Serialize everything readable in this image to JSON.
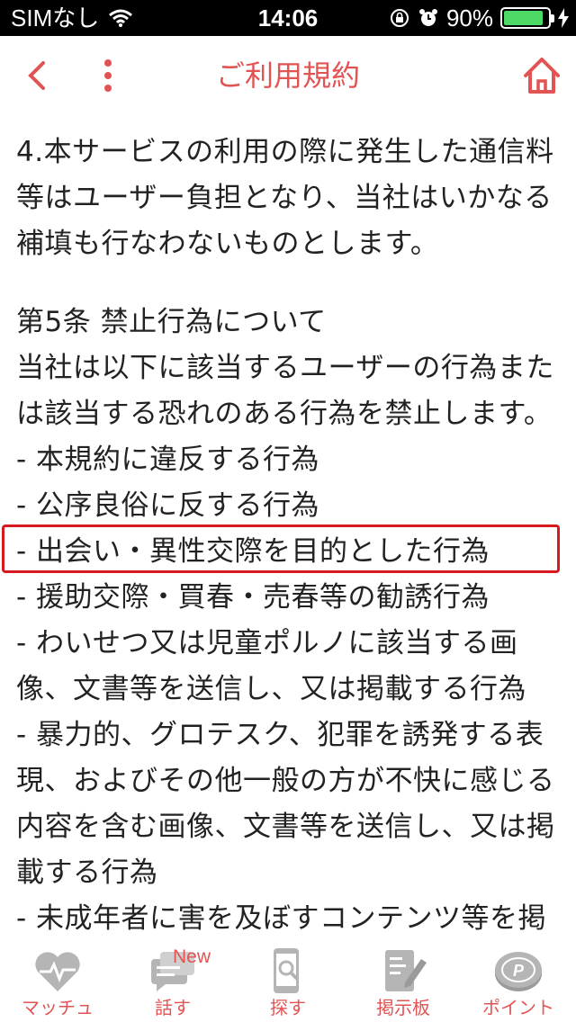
{
  "status_bar": {
    "carrier": "SIMなし",
    "time": "14:06",
    "battery": "90%",
    "battery_level": 0.9
  },
  "nav": {
    "title": "ご利用規約"
  },
  "content": {
    "para1": [
      "4.本サービスの利用の際に発生した通信料",
      "等はユーザー負担となり、当社はいかなる",
      "補填も行なわないものとします。"
    ],
    "para2": [
      "第5条 禁止行為について",
      "当社は以下に該当するユーザーの行為また",
      "は該当する恐れのある行為を禁止します。",
      "- 本規約に違反する行為",
      "- 公序良俗に反する行為",
      "- 出会い・異性交際を目的とした行為",
      "- 援助交際・買春・売春等の勧誘行為",
      "- わいせつ又は児童ポルノに該当する画",
      "像、文書等を送信し、又は掲載する行為",
      "- 暴力的、グロテスク、犯罪を誘発する表",
      "現、およびその他一般の方が不快に感じる",
      "内容を含む画像、文書等を送信し、又は掲",
      "載する行為",
      "- 未成年者に害を及ぼすコンテンツ等を掲"
    ]
  },
  "tabs": [
    {
      "label": "マッチュ",
      "icon": "heart-pulse-icon"
    },
    {
      "label": "話す",
      "icon": "chat-icon",
      "badge": "New"
    },
    {
      "label": "探す",
      "icon": "phone-search-icon"
    },
    {
      "label": "掲示板",
      "icon": "board-pen-icon"
    },
    {
      "label": "ポイント",
      "icon": "coin-icon"
    }
  ],
  "colors": {
    "accent": "#e25353",
    "highlight_border": "#d71920",
    "tab_icon": "#b5b5b5"
  }
}
